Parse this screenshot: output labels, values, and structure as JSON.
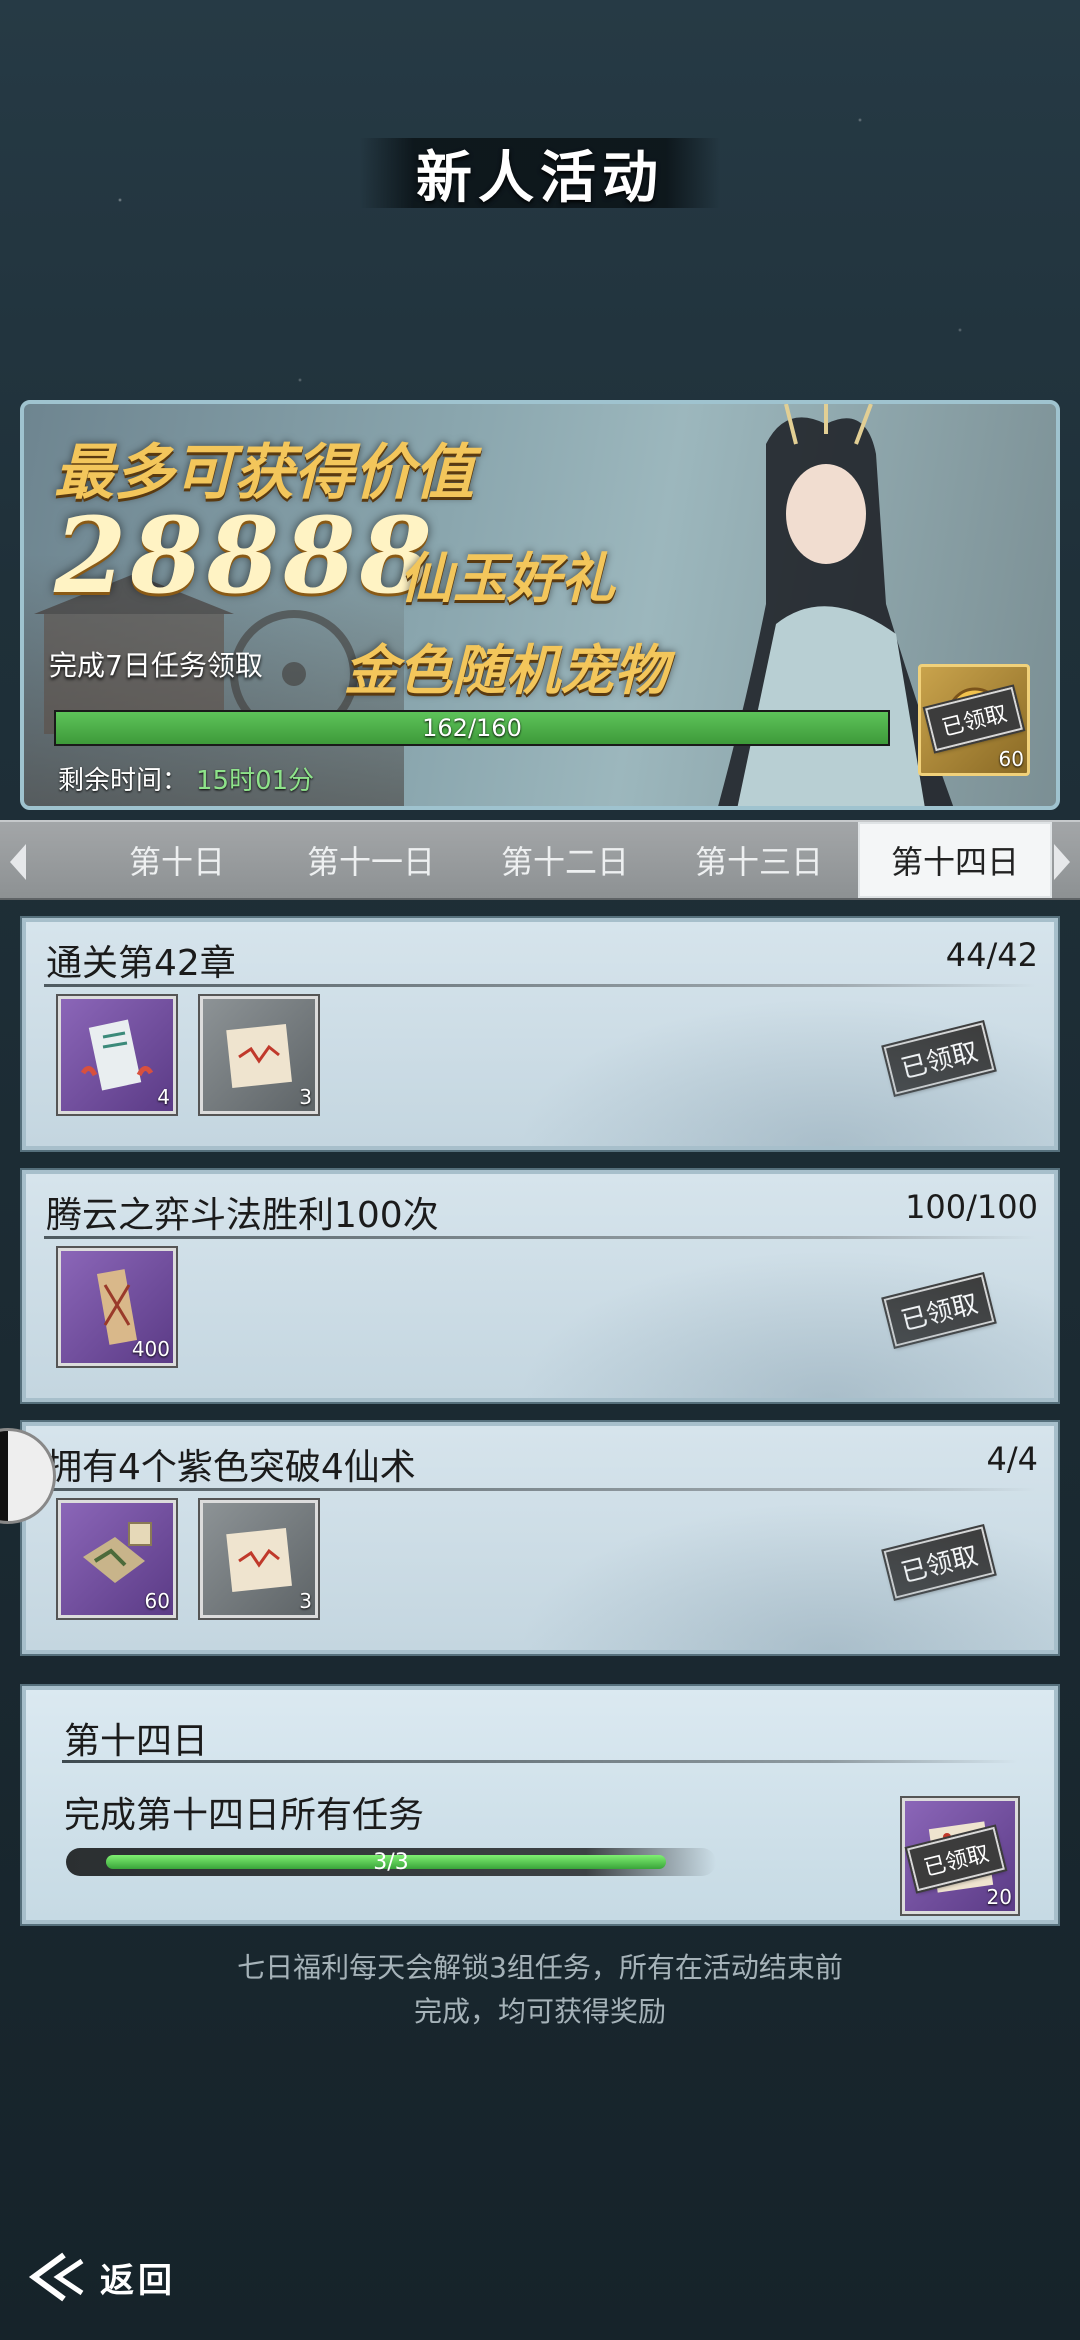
{
  "header": {
    "title": "新人活动"
  },
  "banner": {
    "line1": "最多可获得价值",
    "amount": "28888",
    "gift": "仙玉好礼",
    "task_text": "完成7日任务领取",
    "pet_text": "金色随机宠物",
    "progress_text": "162/160",
    "progress_fraction": 1.0,
    "remain_label": "剩余时间：",
    "remain_value": "15时01分",
    "reward": {
      "stamp": "已领取",
      "qty": "60"
    }
  },
  "tabs": [
    {
      "label": "第十日",
      "active": false
    },
    {
      "label": "第十一日",
      "active": false
    },
    {
      "label": "第十二日",
      "active": false
    },
    {
      "label": "第十三日",
      "active": false
    },
    {
      "label": "第十四日",
      "active": true
    }
  ],
  "tasks": [
    {
      "title": "通关第42章",
      "progress": "44/42",
      "stamp": "已领取",
      "items": [
        {
          "icon": "scroll-icon",
          "rarity": "purple",
          "qty": "4"
        },
        {
          "icon": "paper-icon",
          "rarity": "gray",
          "qty": "3"
        }
      ]
    },
    {
      "title": "腾云之弈斗法胜利100次",
      "progress": "100/100",
      "stamp": "已领取",
      "items": [
        {
          "icon": "map-scroll-icon",
          "rarity": "purple",
          "qty": "400"
        }
      ]
    },
    {
      "title": "拥有4个紫色突破4仙术",
      "progress": "4/4",
      "stamp": "已领取",
      "items": [
        {
          "icon": "puzzle-scroll-icon",
          "rarity": "purple",
          "qty": "60"
        },
        {
          "icon": "paper-icon",
          "rarity": "gray",
          "qty": "3"
        }
      ]
    }
  ],
  "day_summary": {
    "title": "第十四日",
    "desc": "完成第十四日所有任务",
    "progress_text": "3/3",
    "progress_fraction": 1.0,
    "reward": {
      "stamp": "已领取",
      "qty": "20",
      "icon": "paw-scroll-icon"
    }
  },
  "footer": {
    "line1": "七日福利每天会解锁3组任务，所有在活动结束前",
    "line2": "完成，均可获得奖励"
  },
  "back": {
    "label": "返回"
  },
  "colors": {
    "accent_gold": "#f3c65b",
    "progress_green": "#5ec35a",
    "rarity_purple": "#8b66b8"
  }
}
